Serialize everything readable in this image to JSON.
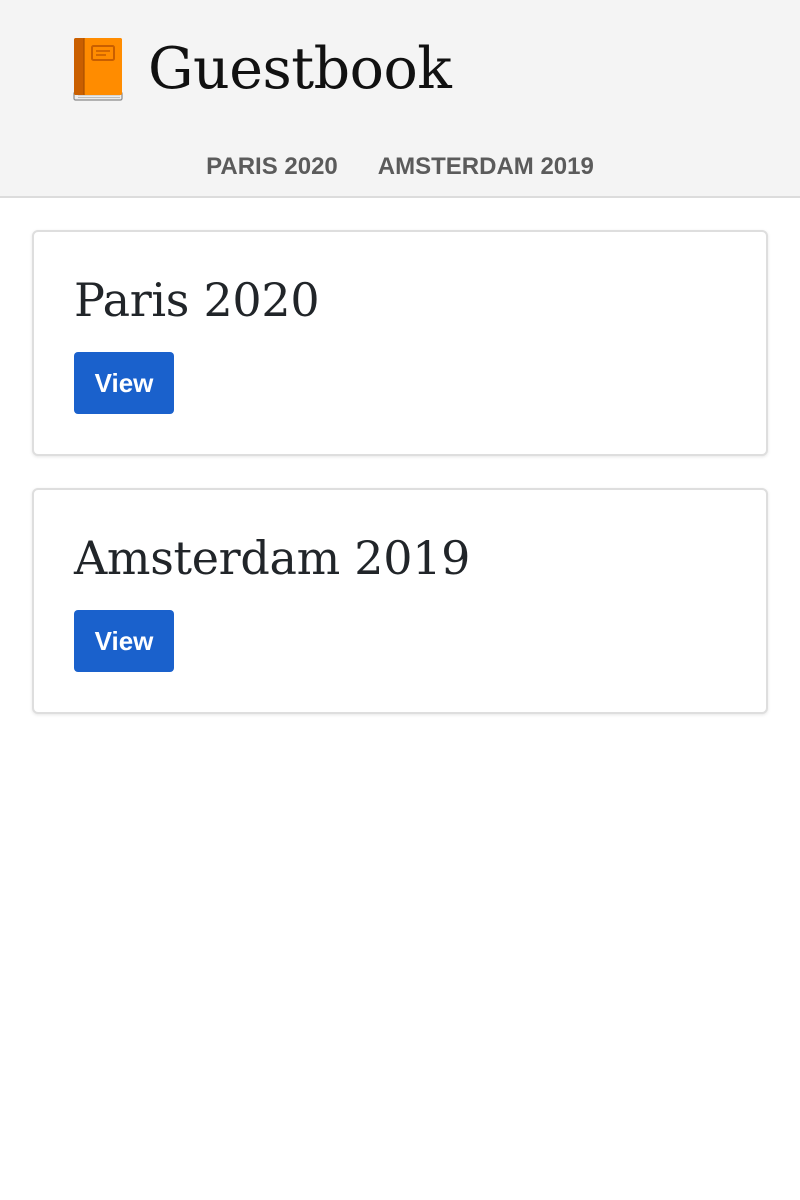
{
  "header": {
    "title": "Guestbook",
    "icon": "orange-book-icon",
    "nav": [
      {
        "label": "Paris 2020"
      },
      {
        "label": "Amsterdam 2019"
      }
    ]
  },
  "trips": [
    {
      "title": "Paris 2020",
      "button_label": "View"
    },
    {
      "title": "Amsterdam 2019",
      "button_label": "View"
    }
  ],
  "colors": {
    "header_bg": "#f4f4f4",
    "nav_text": "#5b5b5b",
    "button_bg": "#1a61cc",
    "button_text": "#ffffff",
    "book_orange": "#f57c00"
  }
}
